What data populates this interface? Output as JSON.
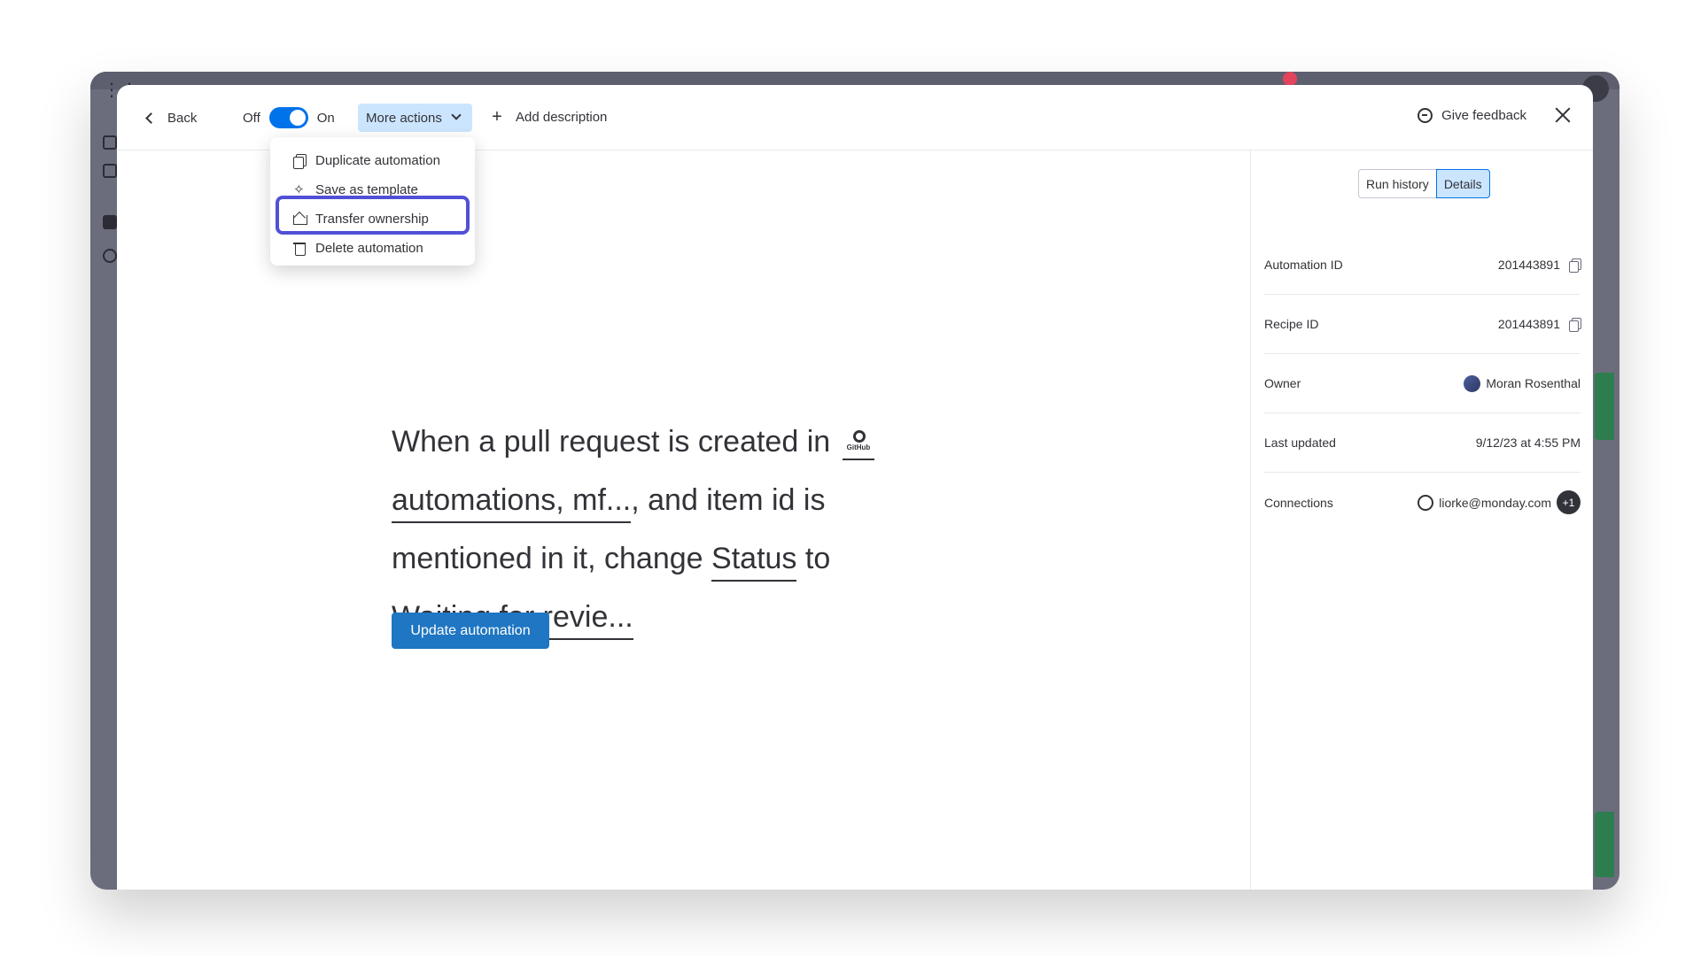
{
  "header": {
    "back_label": "Back",
    "toggle_off_label": "Off",
    "toggle_on_label": "On",
    "more_actions_label": "More actions",
    "add_description_label": "Add description",
    "give_feedback_label": "Give feedback"
  },
  "menu": {
    "items": [
      {
        "label": "Duplicate automation",
        "icon": "duplicate-icon"
      },
      {
        "label": "Save as template",
        "icon": "magic-wand-icon"
      },
      {
        "label": "Transfer ownership",
        "icon": "crown-icon"
      },
      {
        "label": "Delete automation",
        "icon": "trash-icon"
      }
    ],
    "highlight_color": "#5150d6"
  },
  "automation": {
    "part1": "When a pull request is created in",
    "github_logo_text": "GitHub",
    "repo_token": "automations, mf...",
    "part2": ", and item id is",
    "part3": "mentioned in it, change",
    "column_token": "Status",
    "part4": "to",
    "value_token": "Waiting for revie...",
    "update_button_label": "Update automation"
  },
  "details": {
    "tabs": [
      "Run history",
      "Details"
    ],
    "active_tab": "Details",
    "rows": [
      {
        "label": "Automation ID",
        "value": "201443891"
      },
      {
        "label": "Recipe ID",
        "value": "201443891"
      },
      {
        "label": "Owner",
        "value": "Moran Rosenthal"
      },
      {
        "label": "Last updated",
        "value": "9/12/23 at 4:55 PM"
      },
      {
        "label": "Connections",
        "value": "liorke@monday.com",
        "extra_badge": "+1"
      }
    ]
  },
  "colors": {
    "primary": "#0073ea",
    "button": "#1f76c2",
    "active_bg": "#cce5ff",
    "text": "#323338"
  }
}
